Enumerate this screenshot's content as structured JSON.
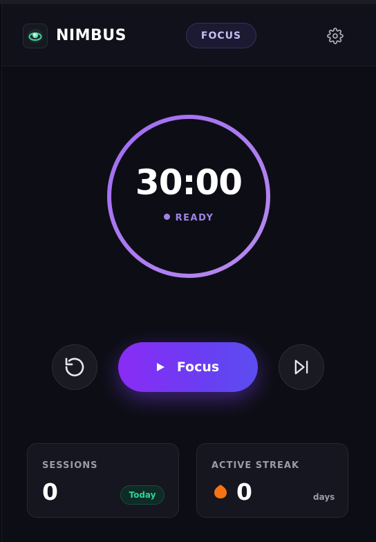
{
  "app": {
    "brand": "NIMBUS",
    "mode": "FOCUS"
  },
  "timer": {
    "time": "30:00",
    "status": "READY"
  },
  "controls": {
    "focus_label": "Focus"
  },
  "stats": {
    "sessions_label": "SESSIONS",
    "sessions_value": "0",
    "sessions_badge": "Today",
    "streak_label": "ACTIVE STREAK",
    "streak_value": "0",
    "streak_unit": "days"
  },
  "icons": {
    "logo": "nimbus-logo-icon",
    "settings": "gear-icon",
    "reset": "reset-icon",
    "skip": "skip-next-icon",
    "play": "play-icon",
    "streak": "flame-icon"
  },
  "colors": {
    "accent": "#9e83e8",
    "ring": "#a77ff0",
    "button_start": "#8a2cf5",
    "button_end": "#5b4ef0",
    "success": "#2fd39a",
    "streak": "#f57314"
  }
}
